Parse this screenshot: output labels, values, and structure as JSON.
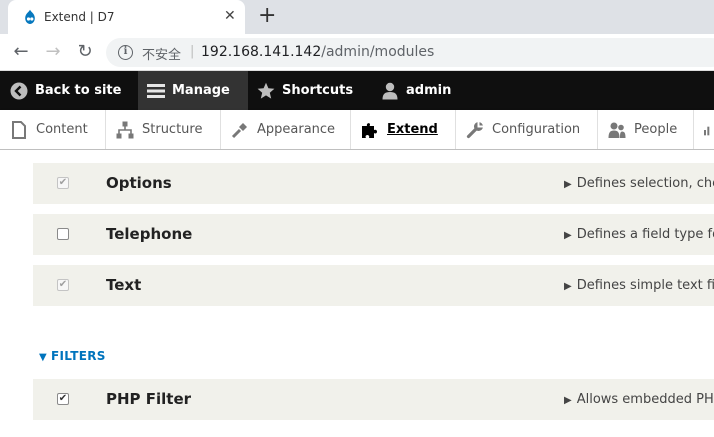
{
  "browser": {
    "tab_title": "Extend | D7",
    "close_glyph": "✕",
    "new_tab_glyph": "+",
    "back_glyph": "←",
    "forward_glyph": "→",
    "reload_glyph": "↻",
    "info_glyph": "i",
    "security_label": "不安全",
    "separator": "|",
    "url_host": "192.168.141.142",
    "url_path": "/admin/modules"
  },
  "admin_toolbar": {
    "items": [
      {
        "label": "Back to site",
        "icon": "back-circle-icon"
      },
      {
        "label": "Manage",
        "icon": "menu-icon",
        "active": true
      },
      {
        "label": "Shortcuts",
        "icon": "star-icon"
      },
      {
        "label": "admin",
        "icon": "user-icon"
      }
    ]
  },
  "tray": {
    "items": [
      {
        "label": "Content",
        "icon": "page-icon"
      },
      {
        "label": "Structure",
        "icon": "structure-icon"
      },
      {
        "label": "Appearance",
        "icon": "brush-icon"
      },
      {
        "label": "Extend",
        "icon": "puzzle-icon",
        "active": true
      },
      {
        "label": "Configuration",
        "icon": "wrench-icon"
      },
      {
        "label": "People",
        "icon": "people-icon"
      }
    ]
  },
  "modules": [
    {
      "name": "Options",
      "checked": true,
      "disabled": true,
      "description": "Defines selection, che"
    },
    {
      "name": "Telephone",
      "checked": false,
      "disabled": false,
      "description": "Defines a field type fo"
    },
    {
      "name": "Text",
      "checked": true,
      "disabled": true,
      "description": "Defines simple text fi"
    }
  ],
  "filters_section": {
    "label": "FILTERS",
    "caret": "▼",
    "modules": [
      {
        "name": "PHP Filter",
        "checked": true,
        "disabled": false,
        "description": "Allows embedded PHP"
      }
    ]
  },
  "colors": {
    "admin_bar_bg": "#0f0f0f",
    "row_bg": "#f1f1eb",
    "section_link": "#0074bd"
  }
}
